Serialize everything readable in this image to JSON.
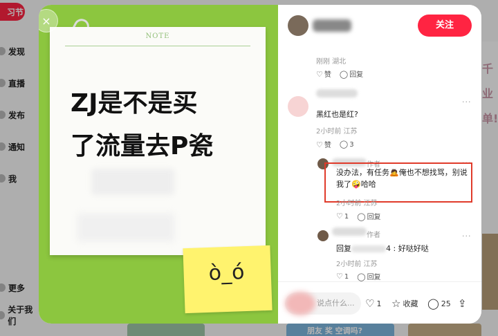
{
  "background": {
    "logo_label": "习节",
    "nav": [
      "发现",
      "直播",
      "发布",
      "通知",
      "我"
    ],
    "nav_bottom": [
      "更多",
      "关于我们"
    ],
    "right_text": "千业单!",
    "bottom_card_text": "朋友 奖 空调吗?"
  },
  "modal": {
    "close_icon": "×",
    "image": {
      "note_header": "NOTE",
      "note_text_line1": "ZJ是不是买",
      "note_text_line2": "了流量去P瓷",
      "sticky_face": "ò_ó"
    },
    "header": {
      "follow_label": "关注"
    },
    "comments": {
      "top_meta": "刚刚 湖北",
      "like_label": "赞",
      "reply_label": "回复",
      "c1": {
        "text": "黑红也是红?",
        "meta": "2小时前 江苏",
        "like_label": "赞",
        "reply_count": "3"
      },
      "c2": {
        "author_tag": "作者",
        "text": "没办法，有任务🙇俺也不想找骂，别说我了🤪哈哈",
        "meta": "2小时前 江苏",
        "like_count": "1",
        "reply_label": "回复"
      },
      "c3": {
        "author_tag": "作者",
        "text_prefix": "回复",
        "text_suffix": "4 : 好哒好哒",
        "meta": "2小时前 江苏",
        "like_count": "1",
        "reply_label": "回复"
      }
    },
    "footer": {
      "input_placeholder": "说点什么...",
      "like_count": "1",
      "collect_label": "收藏",
      "comment_count": "25"
    }
  }
}
